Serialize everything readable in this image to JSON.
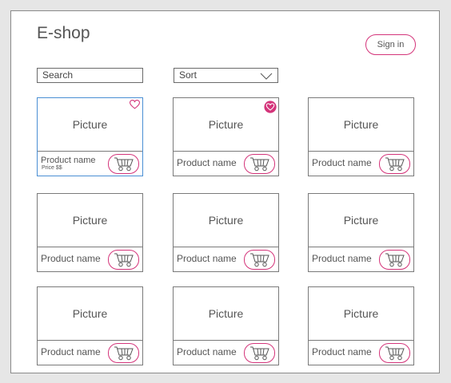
{
  "header": {
    "logo": "E-shop",
    "sign_in_label": "Sign in"
  },
  "toolbar": {
    "search_value": "Search",
    "sort_value": "Sort"
  },
  "products": [
    {
      "picture": "Picture",
      "name": "Product name",
      "price": "Price $$",
      "favorite": "outline",
      "selected": true
    },
    {
      "picture": "Picture",
      "name": "Product name",
      "favorite": "filled"
    },
    {
      "picture": "Picture",
      "name": "Product name"
    },
    {
      "picture": "Picture",
      "name": "Product name"
    },
    {
      "picture": "Picture",
      "name": "Product name"
    },
    {
      "picture": "Picture",
      "name": "Product name"
    },
    {
      "picture": "Picture",
      "name": "Product name"
    },
    {
      "picture": "Picture",
      "name": "Product name"
    },
    {
      "picture": "Picture",
      "name": "Product name"
    }
  ],
  "icons": {
    "cart": "shopping-cart-icon",
    "favorite": "heart-icon",
    "sort": "chevron-down-icon"
  },
  "colors": {
    "accent": "#d4347a",
    "selection": "#4a8fd4",
    "border": "#7a7a7a"
  }
}
